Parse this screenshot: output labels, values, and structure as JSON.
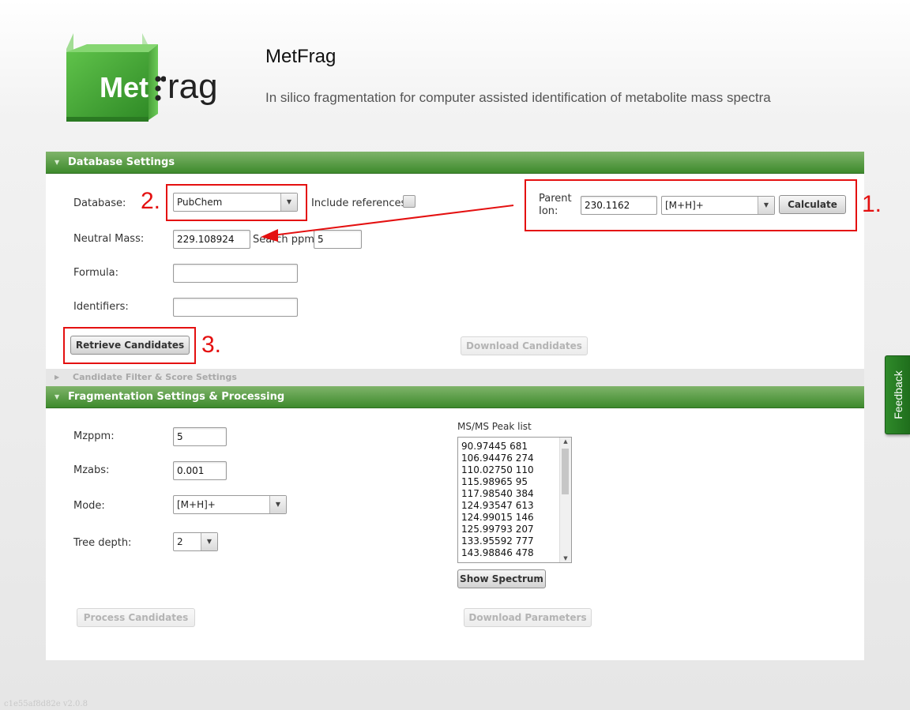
{
  "header": {
    "logo_met": "Met",
    "logo_frag": "Frag",
    "title": "MetFrag",
    "subtitle": "In silico fragmentation for computer assisted identification of metabolite mass spectra"
  },
  "database_settings": {
    "bar_label": "Database Settings",
    "database_label": "Database:",
    "database_value": "PubChem",
    "include_references_label": "Include references:",
    "parent_ion_label_1": "Parent",
    "parent_ion_label_2": "Ion:",
    "parent_ion_value": "230.1162",
    "ion_type_value": "[M+H]+",
    "calculate_label": "Calculate",
    "neutral_mass_label": "Neutral Mass:",
    "neutral_mass_value": "229.108924",
    "search_ppm_label": "Search ppm:",
    "search_ppm_value": "5",
    "formula_label": "Formula:",
    "formula_value": "",
    "identifiers_label": "Identifiers:",
    "identifiers_value": "",
    "retrieve_label": "Retrieve Candidates",
    "download_candidates_label": "Download Candidates"
  },
  "annotations": {
    "step1": "1.",
    "step2": "2.",
    "step3": "3."
  },
  "candidate_filter": {
    "bar_label": "Candidate Filter & Score Settings"
  },
  "fragmentation": {
    "bar_label": "Fragmentation Settings & Processing",
    "mzppm_label": "Mzppm:",
    "mzppm_value": "5",
    "mzabs_label": "Mzabs:",
    "mzabs_value": "0.001",
    "mode_label": "Mode:",
    "mode_value": "[M+H]+",
    "tree_depth_label": "Tree depth:",
    "tree_depth_value": "2",
    "peak_list_label": "MS/MS Peak list",
    "peaks": [
      "90.97445 681",
      "106.94476 274",
      "110.02750 110",
      "115.98965 95",
      "117.98540 384",
      "124.93547 613",
      "124.99015 146",
      "125.99793 207",
      "133.95592 777",
      "143.98846 478"
    ],
    "show_spectrum_label": "Show Spectrum",
    "process_label": "Process Candidates",
    "download_parameters_label": "Download Parameters"
  },
  "feedback_label": "Feedback",
  "version": "c1e55af8d82e v2.0.8",
  "colors": {
    "bar_green": "#3d8a2c",
    "annotation_red": "#e41010",
    "feedback_green": "#2f8a2a"
  }
}
